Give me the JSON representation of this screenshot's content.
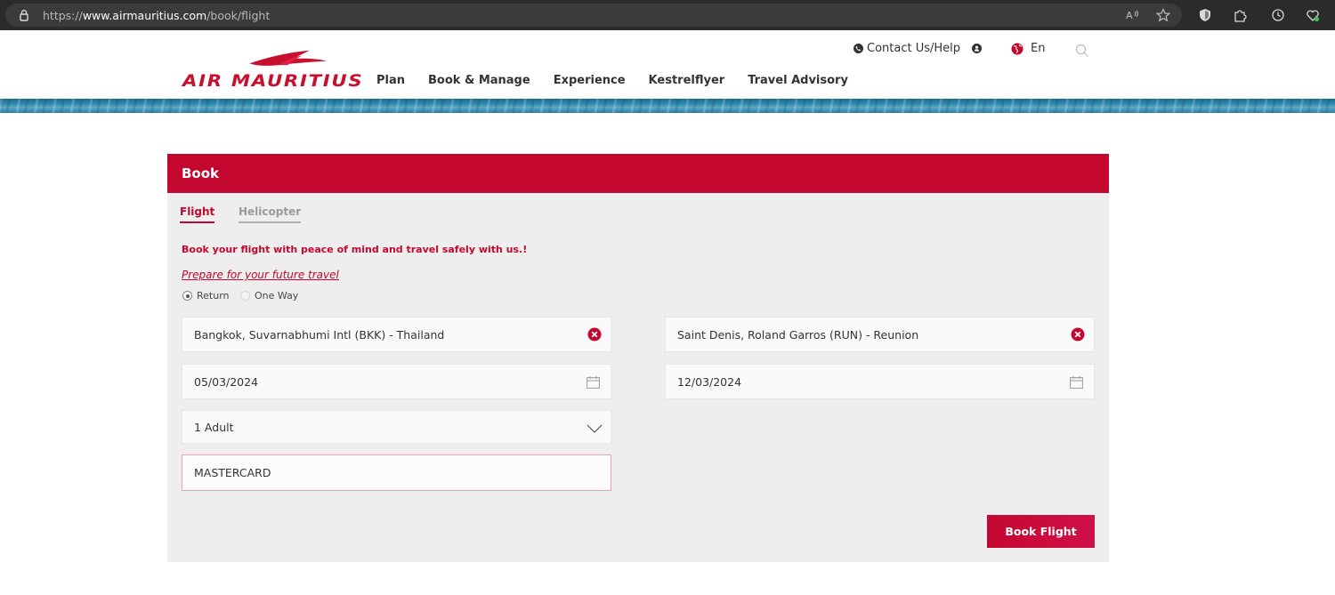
{
  "browser": {
    "url_prefix": "https://",
    "url_domain": "www.airmauritius.com",
    "url_path": "/book/flight"
  },
  "header": {
    "logo_text": "AIR MAURITIUS",
    "nav": [
      "Plan",
      "Book & Manage",
      "Experience",
      "Kestrelflyer",
      "Travel Advisory"
    ],
    "contact_label": "Contact Us/Help",
    "language": "En"
  },
  "panel": {
    "title": "Book",
    "tabs": [
      {
        "label": "Flight",
        "active": true
      },
      {
        "label": "Helicopter",
        "active": false
      }
    ],
    "promo_text": "Book your flight with peace of mind and travel safely with us.!",
    "prepare_link": "Prepare for your future travel",
    "trip_types": [
      {
        "label": "Return",
        "selected": true
      },
      {
        "label": "One Way",
        "selected": false
      }
    ],
    "origin": "Bangkok, Suvarnabhumi Intl (BKK) - Thailand",
    "destination": "Saint Denis, Roland Garros (RUN) - Reunion",
    "depart_date": "05/03/2024",
    "return_date": "12/03/2024",
    "passengers": "1 Adult",
    "promo_code": "MASTERCARD",
    "submit_label": "Book Flight"
  },
  "colors": {
    "brand_red": "#c4072f",
    "panel_bg": "#eeeeee"
  }
}
